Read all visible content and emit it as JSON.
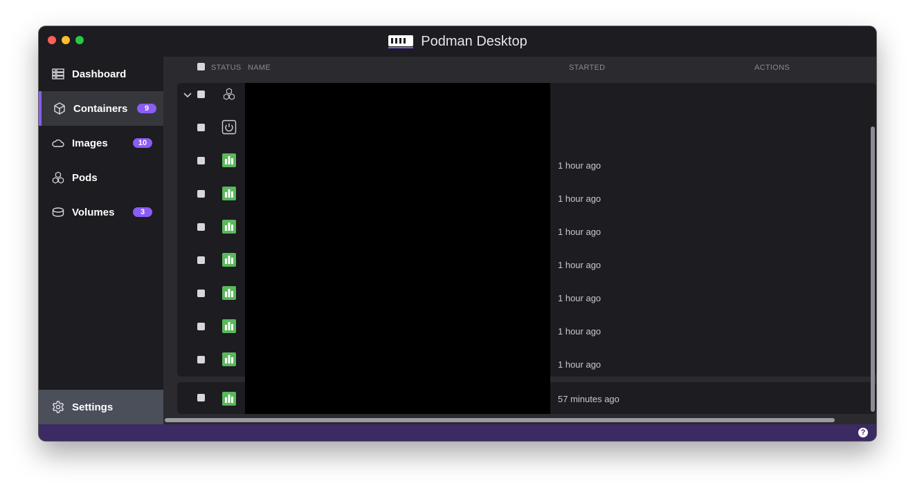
{
  "window": {
    "title": "Podman Desktop"
  },
  "sidebar": {
    "items": [
      {
        "label": "Dashboard",
        "icon": "dashboard-icon",
        "badge": ""
      },
      {
        "label": "Containers",
        "icon": "cube-icon",
        "badge": "9",
        "active": true
      },
      {
        "label": "Images",
        "icon": "cloud-icon",
        "badge": "10"
      },
      {
        "label": "Pods",
        "icon": "cubes-icon",
        "badge": ""
      },
      {
        "label": "Volumes",
        "icon": "database-icon",
        "badge": "3"
      }
    ],
    "settings_label": "Settings"
  },
  "table": {
    "headers": {
      "status": "STATUS",
      "name": "NAME",
      "started": "STARTED",
      "actions": "ACTIONS"
    },
    "group_rows": [
      {
        "status": "pod-group",
        "started": ""
      },
      {
        "status": "stopped",
        "started": ""
      },
      {
        "status": "running",
        "started": "1 hour ago"
      },
      {
        "status": "running",
        "started": "1 hour ago"
      },
      {
        "status": "running",
        "started": "1 hour ago"
      },
      {
        "status": "running",
        "started": "1 hour ago"
      },
      {
        "status": "running",
        "started": "1 hour ago"
      },
      {
        "status": "running",
        "started": "1 hour ago"
      },
      {
        "status": "running",
        "started": "1 hour ago"
      }
    ],
    "single_rows": [
      {
        "status": "running",
        "started": "57 minutes ago"
      }
    ]
  },
  "colors": {
    "accent": "#8b5cf6",
    "running": "#5bb85c",
    "statusbar": "#3c2a63"
  }
}
